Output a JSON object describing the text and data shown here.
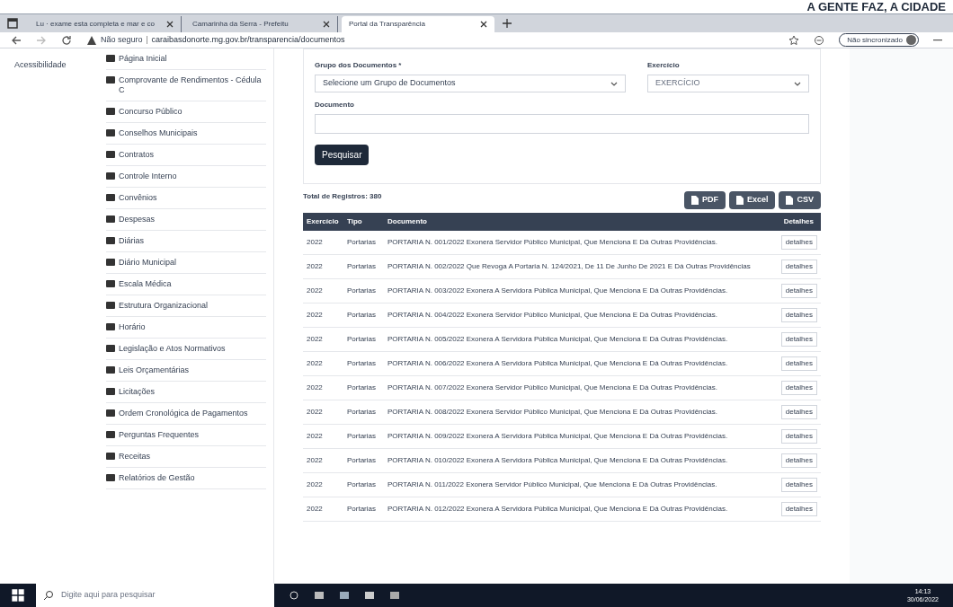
{
  "page_heading": "A GENTE FAZ, A CIDADE",
  "browser": {
    "tabs": [
      {
        "title": "Lu · exame esta completa e mar e co",
        "selected": false
      },
      {
        "title": "Camarinha da Serra - Prefeitu",
        "selected": false
      },
      {
        "title": "Portal da Transparência",
        "selected": true
      }
    ],
    "security": "Não seguro",
    "url": "caraibasdonorte.mg.gov.br/transparencia/documentos",
    "profile": "Não sincronizado"
  },
  "accessibility": "Acessibilidade",
  "sidebar": {
    "items": [
      "Página Inicial",
      "Comprovante de Rendimentos - Cédula C",
      "Concurso Público",
      "Conselhos Municipais",
      "Contratos",
      "Controle Interno",
      "Convênios",
      "Despesas",
      "Diárias",
      "Diário Municipal",
      "Escala Médica",
      "Estrutura Organizacional",
      "Horário",
      "Legislação e Atos Normativos",
      "Leis Orçamentárias",
      "Licitações",
      "Ordem Cronológica de Pagamentos",
      "Perguntas Frequentes",
      "Receitas",
      "Relatórios de Gestão"
    ]
  },
  "form": {
    "group_label": "Grupo dos Documentos *",
    "group_value": "Selecione um Grupo de Documentos",
    "year_label": "Exercício",
    "year_value": "EXERCÍCIO",
    "document_label": "Documento",
    "search_button": "Pesquisar"
  },
  "total": "Total de Registros: 380",
  "export_buttons": [
    "PDF",
    "Excel",
    "CSV"
  ],
  "table": {
    "columns": [
      "Exercício",
      "Tipo",
      "Documento",
      "Detalhes"
    ],
    "rows": [
      {
        "year": "2022",
        "type": "Portarias",
        "document": "PORTARIA N. 001/2022 Exonera Servidor Público Municipal, Que Menciona E Dá Outras Providências.",
        "action": "detalhes"
      },
      {
        "year": "2022",
        "type": "Portarias",
        "document": "PORTARIA N. 002/2022 Que Revoga A Portaria N. 124/2021, De 11 De Junho De 2021 E Dá Outras Providências",
        "action": "detalhes"
      },
      {
        "year": "2022",
        "type": "Portarias",
        "document": "PORTARIA N. 003/2022 Exonera A Servidora Pública Municipal, Que Menciona E Dá Outras Providências.",
        "action": "detalhes"
      },
      {
        "year": "2022",
        "type": "Portarias",
        "document": "PORTARIA N. 004/2022 Exonera Servidor Público Municipal, Que Menciona E Dá Outras Providências.",
        "action": "detalhes"
      },
      {
        "year": "2022",
        "type": "Portarias",
        "document": "PORTARIA N. 005/2022 Exonera A Servidora Pública Municipal, Que Menciona E Dá Outras Providências.",
        "action": "detalhes"
      },
      {
        "year": "2022",
        "type": "Portarias",
        "document": "PORTARIA N. 006/2022 Exonera A Servidora Pública Municipal, Que Menciona E Dá Outras Providências.",
        "action": "detalhes"
      },
      {
        "year": "2022",
        "type": "Portarias",
        "document": "PORTARIA N. 007/2022 Exonera Servidor Público Municipal, Que Menciona E Dá Outras Providências.",
        "action": "detalhes"
      },
      {
        "year": "2022",
        "type": "Portarias",
        "document": "PORTARIA N. 008/2022 Exonera Servidor Público Municipal, Que Menciona E Dá Outras Providências.",
        "action": "detalhes"
      },
      {
        "year": "2022",
        "type": "Portarias",
        "document": "PORTARIA N. 009/2022 Exonera A Servidora Pública Municipal, Que Menciona E Dá Outras Providências.",
        "action": "detalhes"
      },
      {
        "year": "2022",
        "type": "Portarias",
        "document": "PORTARIA N. 010/2022 Exonera A Servidora Pública Municipal, Que Menciona E Dá Outras Providências.",
        "action": "detalhes"
      },
      {
        "year": "2022",
        "type": "Portarias",
        "document": "PORTARIA N. 011/2022 Exonera Servidor Público Municipal, Que Menciona E Dá Outras Providências.",
        "action": "detalhes"
      },
      {
        "year": "2022",
        "type": "Portarias",
        "document": "PORTARIA N. 012/2022 Exonera A Servidora Pública Municipal, Que Menciona E Dá Outras Providências.",
        "action": "detalhes"
      }
    ]
  },
  "taskbar": {
    "search_placeholder": "Digite aqui para pesquisar",
    "time": "14:13",
    "date": "30/06/2022"
  }
}
